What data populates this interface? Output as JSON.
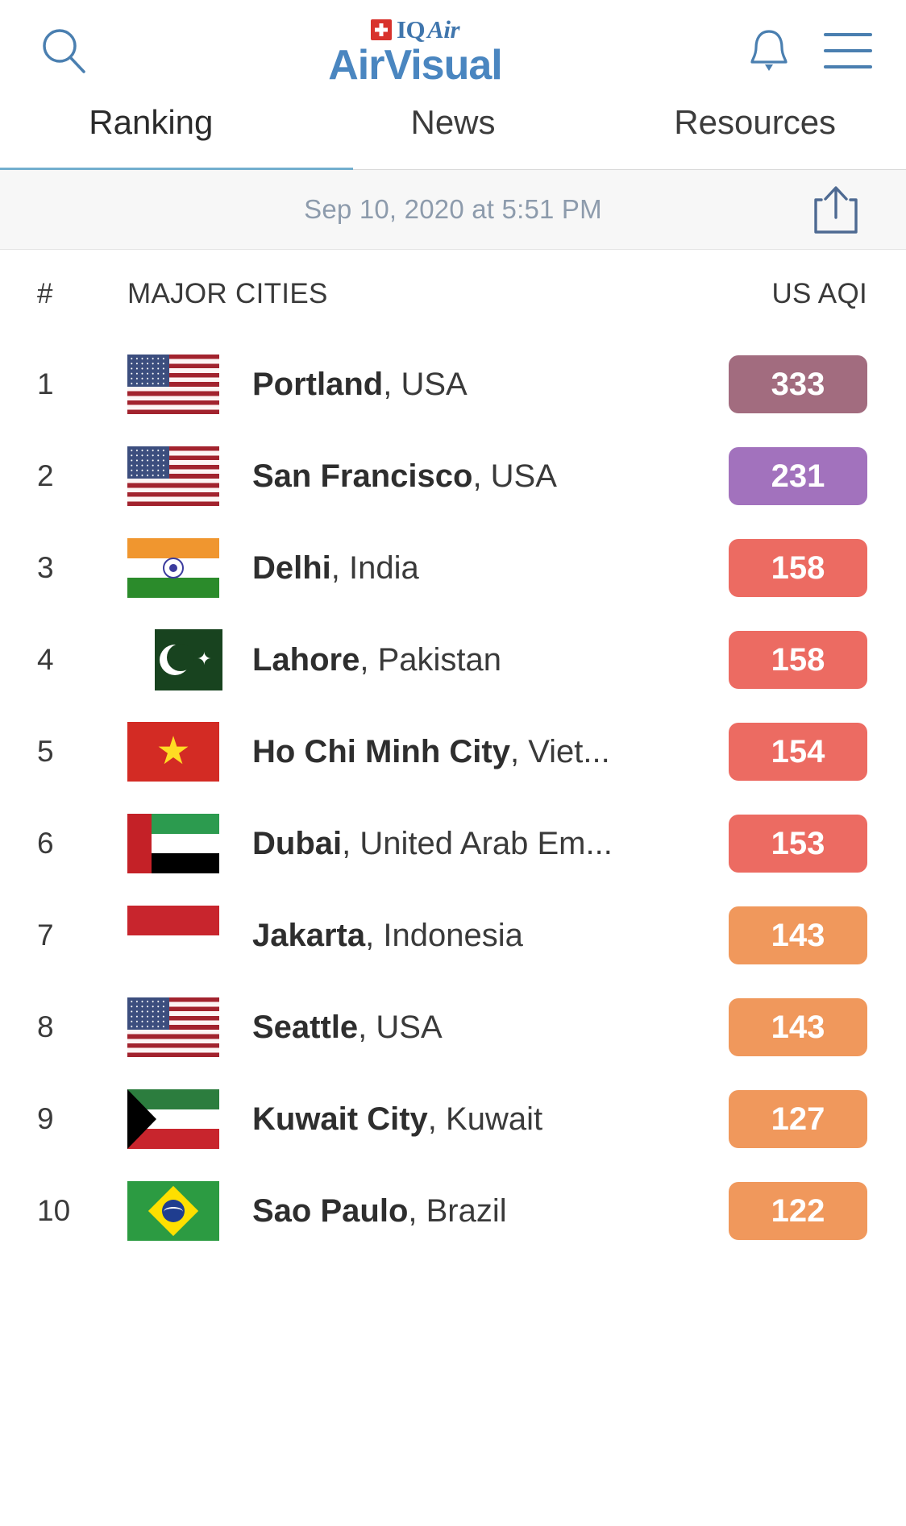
{
  "header": {
    "search_icon": "search-icon",
    "logo": {
      "brand_mark": "IQ",
      "brand_mark_italic": "Air",
      "product": "AirVisual",
      "swiss_flag_icon": "swiss-cross-icon"
    },
    "bell_icon": "notification-bell-icon",
    "menu_icon": "hamburger-menu-icon"
  },
  "tabs": [
    {
      "label": "Ranking",
      "active": true
    },
    {
      "label": "News",
      "active": false
    },
    {
      "label": "Resources",
      "active": false
    }
  ],
  "datebar": {
    "timestamp": "Sep 10, 2020 at 5:51 PM",
    "share_icon": "share-icon"
  },
  "table": {
    "headers": {
      "rank": "#",
      "city": "MAJOR CITIES",
      "aqi": "US AQI"
    },
    "rows": [
      {
        "rank": "1",
        "city": "Portland",
        "sep": ", ",
        "country": "USA",
        "aqi": "333",
        "color": "#a26c7f",
        "flag": "us"
      },
      {
        "rank": "2",
        "city": "San Francisco",
        "sep": ", ",
        "country": "USA",
        "aqi": "231",
        "color": "#a272bd",
        "flag": "us"
      },
      {
        "rank": "3",
        "city": "Delhi",
        "sep": ", ",
        "country": "India",
        "aqi": "158",
        "color": "#ec6b62",
        "flag": "in"
      },
      {
        "rank": "4",
        "city": "Lahore",
        "sep": ", ",
        "country": "Pakistan",
        "aqi": "158",
        "color": "#ec6b62",
        "flag": "pk"
      },
      {
        "rank": "5",
        "city": "Ho Chi Minh City",
        "sep": ", ",
        "country": "Viet...",
        "aqi": "154",
        "color": "#ec6b62",
        "flag": "vn"
      },
      {
        "rank": "6",
        "city": "Dubai",
        "sep": ", ",
        "country": "United Arab Em...",
        "aqi": "153",
        "color": "#ec6b62",
        "flag": "ae"
      },
      {
        "rank": "7",
        "city": "Jakarta",
        "sep": ", ",
        "country": "Indonesia",
        "aqi": "143",
        "color": "#f0985c",
        "flag": "id"
      },
      {
        "rank": "8",
        "city": "Seattle",
        "sep": ", ",
        "country": "USA",
        "aqi": "143",
        "color": "#f0985c",
        "flag": "us"
      },
      {
        "rank": "9",
        "city": "Kuwait City",
        "sep": ", ",
        "country": "Kuwait",
        "aqi": "127",
        "color": "#f0985c",
        "flag": "kw"
      },
      {
        "rank": "10",
        "city": "Sao Paulo",
        "sep": ", ",
        "country": "Brazil",
        "aqi": "122",
        "color": "#f0985c",
        "flag": "br"
      }
    ]
  },
  "colors": {
    "accent_blue": "#4a86c0",
    "tab_underline": "#72aece",
    "aqi_very_unhealthy": "#a272bd",
    "aqi_hazardous": "#a26c7f",
    "aqi_unhealthy": "#ec6b62",
    "aqi_usg": "#f0985c"
  }
}
